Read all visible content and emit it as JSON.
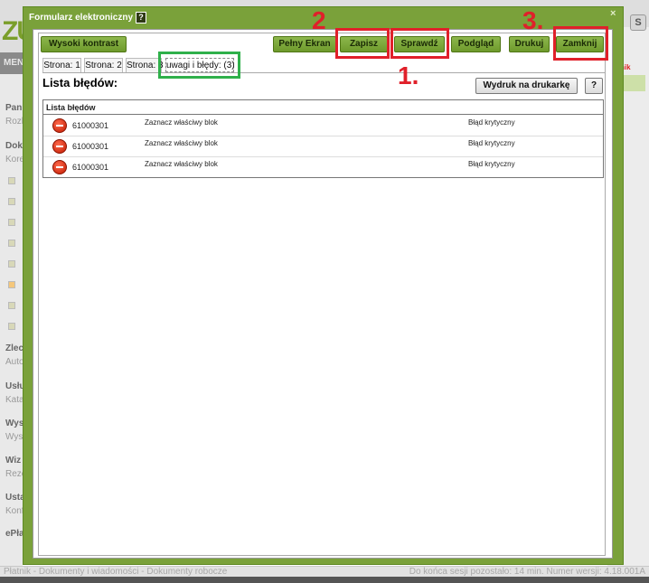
{
  "background": {
    "logo": "ZU",
    "menu_label": "MEN",
    "sidebar": [
      {
        "title": "Pan",
        "sub": "Rozl"
      },
      {
        "title": "Dok",
        "sub": "Kore"
      },
      {
        "title": "Zlec",
        "sub": "Auto"
      },
      {
        "title": "Usłu",
        "sub": "Kata"
      },
      {
        "title": "Wys",
        "sub": "Wys"
      },
      {
        "title": "Wiz",
        "sub": "Reze"
      },
      {
        "title": "Usta",
        "sub": "Konf"
      },
      {
        "title": "ePła",
        "sub": ""
      }
    ],
    "right_badge": "nik",
    "skype_icon": "S",
    "status_left": "Płatnik - Dokumenty i wiadomości - Dokumenty robocze",
    "status_right": "Do końca sesji pozostało: 14 min.   Numer wersji: 4.18.001A"
  },
  "modal": {
    "title": "Formularz elektroniczny",
    "help_icon": "?",
    "close": "×"
  },
  "toolbar": {
    "high_contrast": "Wysoki kontrast",
    "fullscreen": "Pełny Ekran",
    "save": "Zapisz",
    "check": "Sprawdź",
    "preview": "Podgląd",
    "print": "Drukuj",
    "close": "Zamknij"
  },
  "tabs": [
    {
      "label": "Strona: 1"
    },
    {
      "label": "Strona: 2"
    },
    {
      "label": "Strona: 3"
    },
    {
      "label": "uwagi i błędy: (3)"
    }
  ],
  "errors": {
    "heading": "Lista błędów:",
    "print_button": "Wydruk na drukarkę",
    "help_button": "?",
    "table_header": "Lista błędów",
    "rows": [
      {
        "code": "61000301",
        "description": "Zaznacz właściwy blok",
        "level": "Błąd krytyczny"
      },
      {
        "code": "61000301",
        "description": "Zaznacz właściwy blok",
        "level": "Błąd krytyczny"
      },
      {
        "code": "61000301",
        "description": "Zaznacz właściwy blok",
        "level": "Błąd krytyczny"
      }
    ]
  },
  "annotations": {
    "step_check": "1.",
    "step_save": "2",
    "step_close": "3.",
    "red_color": "#e0202a",
    "green_color": "#2fb04a"
  }
}
